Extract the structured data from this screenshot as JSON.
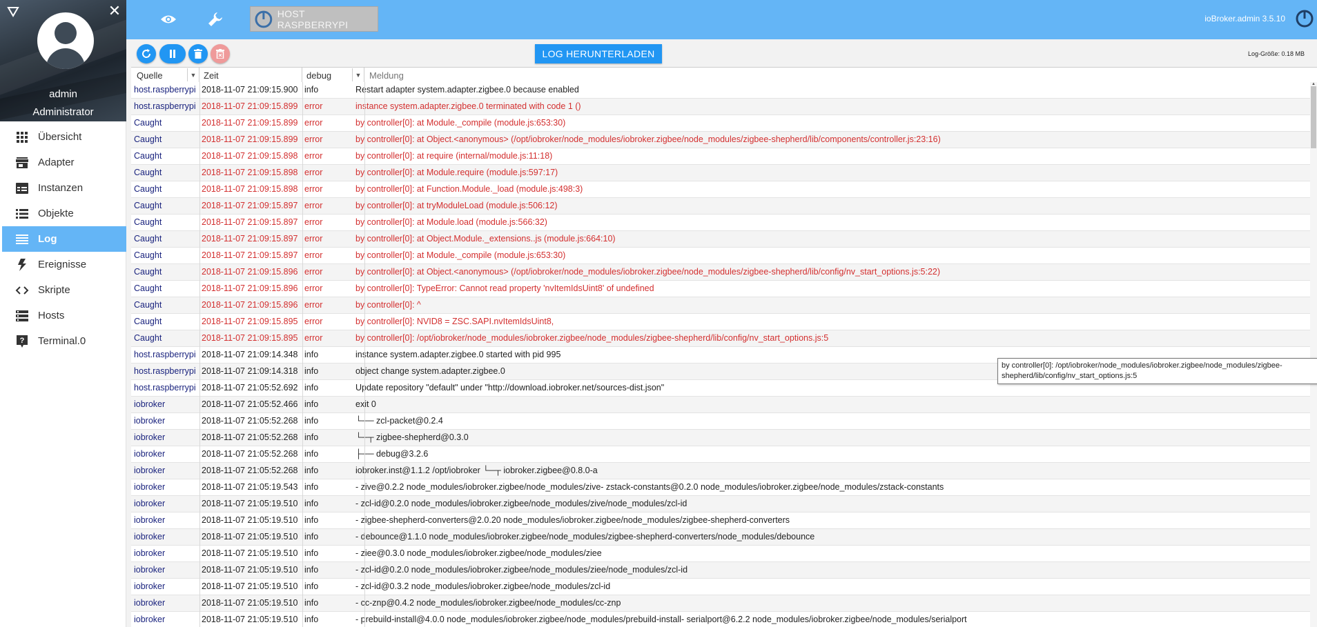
{
  "app": {
    "version": "ioBroker.admin 3.5.10",
    "host_button_label": "HOST RASPBERRYPI"
  },
  "user": {
    "name": "admin",
    "role": "Administrator"
  },
  "nav": {
    "items": [
      {
        "label": "Übersicht",
        "icon": "grid-icon"
      },
      {
        "label": "Adapter",
        "icon": "store-icon"
      },
      {
        "label": "Instanzen",
        "icon": "instances-icon"
      },
      {
        "label": "Objekte",
        "icon": "list-icon"
      },
      {
        "label": "Log",
        "icon": "log-icon",
        "active": true
      },
      {
        "label": "Ereignisse",
        "icon": "lightning-icon"
      },
      {
        "label": "Skripte",
        "icon": "code-icon"
      },
      {
        "label": "Hosts",
        "icon": "hosts-icon"
      },
      {
        "label": "Terminal.0",
        "icon": "help-icon"
      }
    ]
  },
  "toolbar": {
    "download_label": "LOG HERUNTERLADEN",
    "log_size": "Log-Größe: 0.18 MB"
  },
  "filters": {
    "source": "Quelle",
    "time": "Zeit",
    "severity": "debug",
    "message_placeholder": "Meldung"
  },
  "colors": {
    "accent": "#64b5f6",
    "button": "#2196f3",
    "error": "#d32f2f",
    "source": "#1a237e"
  },
  "log_rows": [
    {
      "source": "host.raspberrypi",
      "time": "2018-11-07 21:09:15.900",
      "severity": "info",
      "message": "Restart adapter system.adapter.zigbee.0 because enabled"
    },
    {
      "source": "host.raspberrypi",
      "time": "2018-11-07 21:09:15.899",
      "severity": "error",
      "message": "instance system.adapter.zigbee.0 terminated with code 1 ()"
    },
    {
      "source": "Caught",
      "time": "2018-11-07 21:09:15.899",
      "severity": "error",
      "message": "by controller[0]: at Module._compile (module.js:653:30)"
    },
    {
      "source": "Caught",
      "time": "2018-11-07 21:09:15.899",
      "severity": "error",
      "message": "by controller[0]: at Object.<anonymous> (/opt/iobroker/node_modules/iobroker.zigbee/node_modules/zigbee-shepherd/lib/components/controller.js:23:16)"
    },
    {
      "source": "Caught",
      "time": "2018-11-07 21:09:15.898",
      "severity": "error",
      "message": "by controller[0]: at require (internal/module.js:11:18)"
    },
    {
      "source": "Caught",
      "time": "2018-11-07 21:09:15.898",
      "severity": "error",
      "message": "by controller[0]: at Module.require (module.js:597:17)"
    },
    {
      "source": "Caught",
      "time": "2018-11-07 21:09:15.898",
      "severity": "error",
      "message": "by controller[0]: at Function.Module._load (module.js:498:3)"
    },
    {
      "source": "Caught",
      "time": "2018-11-07 21:09:15.897",
      "severity": "error",
      "message": "by controller[0]: at tryModuleLoad (module.js:506:12)"
    },
    {
      "source": "Caught",
      "time": "2018-11-07 21:09:15.897",
      "severity": "error",
      "message": "by controller[0]: at Module.load (module.js:566:32)"
    },
    {
      "source": "Caught",
      "time": "2018-11-07 21:09:15.897",
      "severity": "error",
      "message": "by controller[0]: at Object.Module._extensions..js (module.js:664:10)"
    },
    {
      "source": "Caught",
      "time": "2018-11-07 21:09:15.897",
      "severity": "error",
      "message": "by controller[0]: at Module._compile (module.js:653:30)"
    },
    {
      "source": "Caught",
      "time": "2018-11-07 21:09:15.896",
      "severity": "error",
      "message": "by controller[0]: at Object.<anonymous> (/opt/iobroker/node_modules/iobroker.zigbee/node_modules/zigbee-shepherd/lib/config/nv_start_options.js:5:22)"
    },
    {
      "source": "Caught",
      "time": "2018-11-07 21:09:15.896",
      "severity": "error",
      "message": "by controller[0]: TypeError: Cannot read property 'nvItemIdsUint8' of undefined"
    },
    {
      "source": "Caught",
      "time": "2018-11-07 21:09:15.896",
      "severity": "error",
      "message": "by controller[0]: ^"
    },
    {
      "source": "Caught",
      "time": "2018-11-07 21:09:15.895",
      "severity": "error",
      "message": "by controller[0]: NVID8 = ZSC.SAPI.nvItemIdsUint8,"
    },
    {
      "source": "Caught",
      "time": "2018-11-07 21:09:15.895",
      "severity": "error",
      "message": "by controller[0]: /opt/iobroker/node_modules/iobroker.zigbee/node_modules/zigbee-shepherd/lib/config/nv_start_options.js:5"
    },
    {
      "source": "host.raspberrypi",
      "time": "2018-11-07 21:09:14.348",
      "severity": "info",
      "message": "instance system.adapter.zigbee.0 started with pid 995"
    },
    {
      "source": "host.raspberrypi",
      "time": "2018-11-07 21:09:14.318",
      "severity": "info",
      "message": "object change system.adapter.zigbee.0"
    },
    {
      "source": "host.raspberrypi",
      "time": "2018-11-07 21:05:52.692",
      "severity": "info",
      "message": "Update repository \"default\" under \"http://download.iobroker.net/sources-dist.json\""
    },
    {
      "source": "iobroker",
      "time": "2018-11-07 21:05:52.466",
      "severity": "info",
      "message": "exit 0"
    },
    {
      "source": "iobroker",
      "time": "2018-11-07 21:05:52.268",
      "severity": "info",
      "message": "└── zcl-packet@0.2.4"
    },
    {
      "source": "iobroker",
      "time": "2018-11-07 21:05:52.268",
      "severity": "info",
      "message": "└─┬ zigbee-shepherd@0.3.0"
    },
    {
      "source": "iobroker",
      "time": "2018-11-07 21:05:52.268",
      "severity": "info",
      "message": "├── debug@3.2.6"
    },
    {
      "source": "iobroker",
      "time": "2018-11-07 21:05:52.268",
      "severity": "info",
      "message": "iobroker.inst@1.1.2 /opt/iobroker └─┬ iobroker.zigbee@0.8.0-a"
    },
    {
      "source": "iobroker",
      "time": "2018-11-07 21:05:19.543",
      "severity": "info",
      "message": "- zive@0.2.2 node_modules/iobroker.zigbee/node_modules/zive- zstack-constants@0.2.0 node_modules/iobroker.zigbee/node_modules/zstack-constants"
    },
    {
      "source": "iobroker",
      "time": "2018-11-07 21:05:19.510",
      "severity": "info",
      "message": "- zcl-id@0.2.0 node_modules/iobroker.zigbee/node_modules/zive/node_modules/zcl-id"
    },
    {
      "source": "iobroker",
      "time": "2018-11-07 21:05:19.510",
      "severity": "info",
      "message": "- zigbee-shepherd-converters@2.0.20 node_modules/iobroker.zigbee/node_modules/zigbee-shepherd-converters"
    },
    {
      "source": "iobroker",
      "time": "2018-11-07 21:05:19.510",
      "severity": "info",
      "message": "- debounce@1.1.0 node_modules/iobroker.zigbee/node_modules/zigbee-shepherd-converters/node_modules/debounce"
    },
    {
      "source": "iobroker",
      "time": "2018-11-07 21:05:19.510",
      "severity": "info",
      "message": "- ziee@0.3.0 node_modules/iobroker.zigbee/node_modules/ziee"
    },
    {
      "source": "iobroker",
      "time": "2018-11-07 21:05:19.510",
      "severity": "info",
      "message": "- zcl-id@0.2.0 node_modules/iobroker.zigbee/node_modules/ziee/node_modules/zcl-id"
    },
    {
      "source": "iobroker",
      "time": "2018-11-07 21:05:19.510",
      "severity": "info",
      "message": "- zcl-id@0.3.2 node_modules/iobroker.zigbee/node_modules/zcl-id"
    },
    {
      "source": "iobroker",
      "time": "2018-11-07 21:05:19.510",
      "severity": "info",
      "message": "- cc-znp@0.4.2 node_modules/iobroker.zigbee/node_modules/cc-znp"
    },
    {
      "source": "iobroker",
      "time": "2018-11-07 21:05:19.510",
      "severity": "info",
      "message": "- prebuild-install@4.0.0 node_modules/iobroker.zigbee/node_modules/prebuild-install- serialport@6.2.2 node_modules/iobroker.zigbee/node_modules/serialport"
    }
  ],
  "tooltip": {
    "line1": "by controller[0]: /opt/iobroker/node_modules/iobroker.zigbee/node_modules/zigbee-",
    "line2": "shepherd/lib/config/nv_start_options.js:5"
  }
}
